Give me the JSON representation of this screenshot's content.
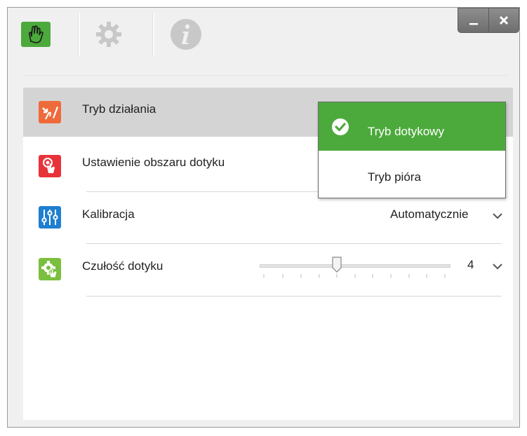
{
  "tabs": [
    {
      "icon": "touch-hand-icon",
      "active": true
    },
    {
      "icon": "gear-icon",
      "active": false
    },
    {
      "icon": "info-icon",
      "active": false
    }
  ],
  "window_controls": {
    "minimize": "_",
    "close": "✕"
  },
  "settings": {
    "mode": {
      "label": "Tryb działania",
      "icon": "mode-icon"
    },
    "touch_area": {
      "label": "Ustawienie obszaru dotyku",
      "icon": "touch-area-icon"
    },
    "calibration": {
      "label": "Kalibracja",
      "value": "Automatycznie",
      "icon": "sliders-icon"
    },
    "sensitivity": {
      "label": "Czułość dotyku",
      "value": "4",
      "icon": "sensitivity-gear-icon"
    }
  },
  "mode_dropdown": {
    "selected": "Tryb dotykowy",
    "other": "Tryb pióra"
  },
  "colors": {
    "accent_green": "#4caa3c",
    "mode_icon": "#ef6a3a",
    "touch_icon": "#e8323a",
    "calib_icon": "#1f7fd0",
    "sens_icon": "#7bbf3e"
  }
}
